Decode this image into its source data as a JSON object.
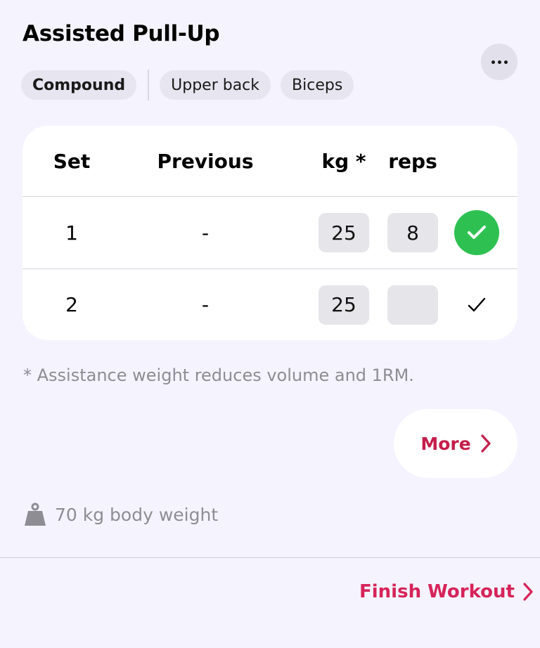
{
  "exercise": {
    "title": "Assisted Pull-Up",
    "tags": [
      "Compound",
      "Upper back",
      "Biceps"
    ]
  },
  "table": {
    "headers": {
      "set": "Set",
      "previous": "Previous",
      "kg": "kg *",
      "reps": "reps"
    },
    "rows": [
      {
        "set": "1",
        "previous": "-",
        "kg": "25",
        "reps": "8",
        "completed": true
      },
      {
        "set": "2",
        "previous": "-",
        "kg": "25",
        "reps": "",
        "completed": false
      }
    ]
  },
  "footnote": "* Assistance weight reduces volume and 1RM.",
  "more_button": {
    "label": "More"
  },
  "body_weight": {
    "text": "70 kg body weight"
  },
  "finish_button": {
    "label": "Finish Workout"
  },
  "colors": {
    "accent": "#c41e4b",
    "finish": "#d6245a",
    "complete": "#2ec152",
    "background": "#f5f3fd"
  }
}
